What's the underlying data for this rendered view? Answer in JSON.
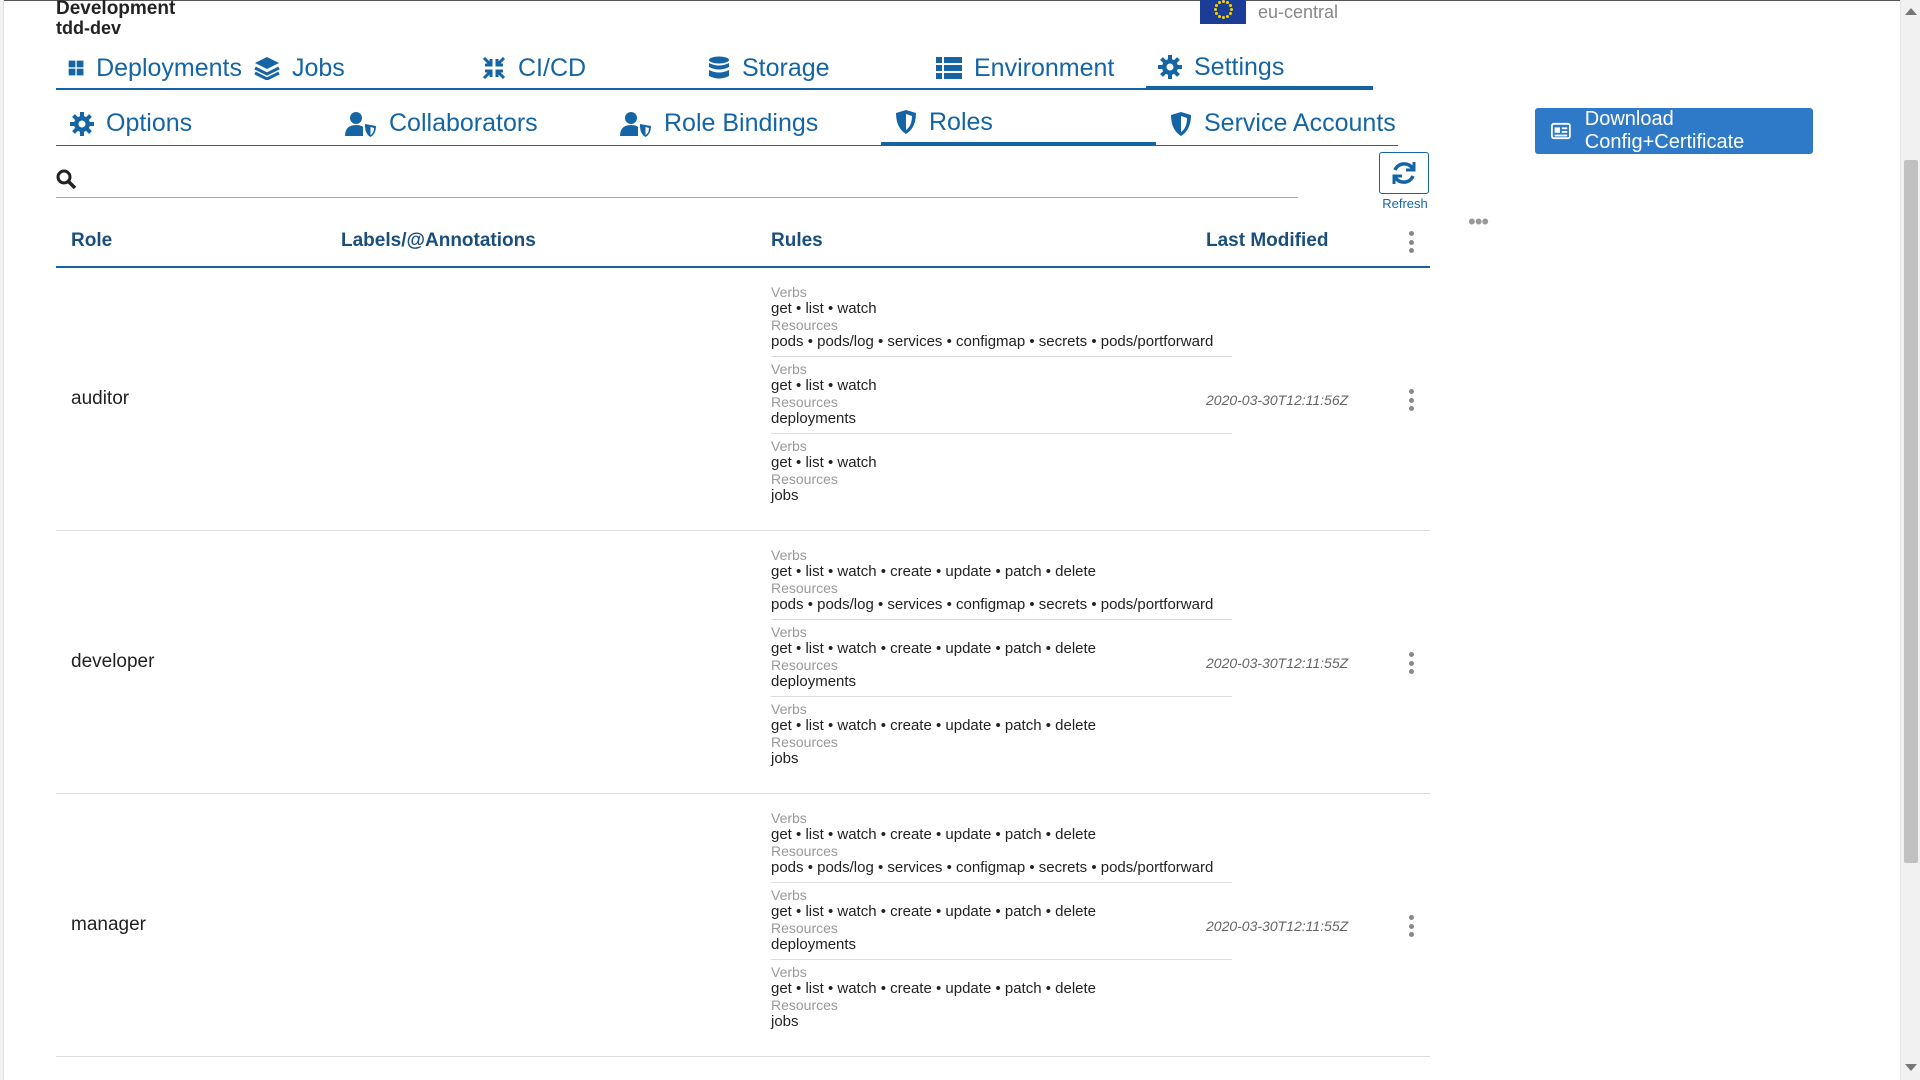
{
  "project": {
    "name": "Development",
    "id": "tdd-dev"
  },
  "region": {
    "label": "eu-central"
  },
  "primary_tabs": [
    {
      "label": "Deployments",
      "icon": "dashboard-icon"
    },
    {
      "label": "Jobs",
      "icon": "layers-icon"
    },
    {
      "label": "CI/CD",
      "icon": "compress-arrows-icon"
    },
    {
      "label": "Storage",
      "icon": "database-icon"
    },
    {
      "label": "Environment",
      "icon": "list-icon"
    },
    {
      "label": "Settings",
      "icon": "gear-icon",
      "active": true
    }
  ],
  "secondary_tabs": [
    {
      "label": "Options",
      "icon": "gear-icon"
    },
    {
      "label": "Collaborators",
      "icon": "user-shield-icon"
    },
    {
      "label": "Role Bindings",
      "icon": "user-shield-icon"
    },
    {
      "label": "Roles",
      "icon": "shield-icon",
      "active": true
    },
    {
      "label": "Service Accounts",
      "icon": "shield-icon"
    }
  ],
  "download_button": {
    "label": "Download Config+Certificate"
  },
  "search": {
    "placeholder": "",
    "value": ""
  },
  "refresh": {
    "label": "Refresh"
  },
  "table": {
    "headers": {
      "role": "Role",
      "labels": "Labels/@Annotations",
      "rules": "Rules",
      "last_modified": "Last Modified"
    },
    "rule_labels": {
      "verbs": "Verbs",
      "resources": "Resources"
    },
    "rows": [
      {
        "role": "auditor",
        "last_modified": "2020-03-30T12:11:56Z",
        "rules": [
          {
            "verbs": "get • list • watch",
            "resources": "pods • pods/log • services • configmap • secrets • pods/portforward"
          },
          {
            "verbs": "get • list • watch",
            "resources": "deployments"
          },
          {
            "verbs": "get • list • watch",
            "resources": "jobs"
          }
        ]
      },
      {
        "role": "developer",
        "last_modified": "2020-03-30T12:11:55Z",
        "rules": [
          {
            "verbs": "get • list • watch • create • update • patch • delete",
            "resources": "pods • pods/log • services • configmap • secrets • pods/portforward"
          },
          {
            "verbs": "get • list • watch • create • update • patch • delete",
            "resources": "deployments"
          },
          {
            "verbs": "get • list • watch • create • update • patch • delete",
            "resources": "jobs"
          }
        ]
      },
      {
        "role": "manager",
        "last_modified": "2020-03-30T12:11:55Z",
        "rules": [
          {
            "verbs": "get • list • watch • create • update • patch • delete",
            "resources": "pods • pods/log • services • configmap • secrets • pods/portforward"
          },
          {
            "verbs": "get • list • watch • create • update • patch • delete",
            "resources": "deployments"
          },
          {
            "verbs": "get • list • watch • create • update • patch • delete",
            "resources": "jobs"
          }
        ]
      }
    ]
  },
  "colors": {
    "accent": "#1565a6",
    "button": "#2f7ac8",
    "header_text": "#1a4f7d"
  }
}
